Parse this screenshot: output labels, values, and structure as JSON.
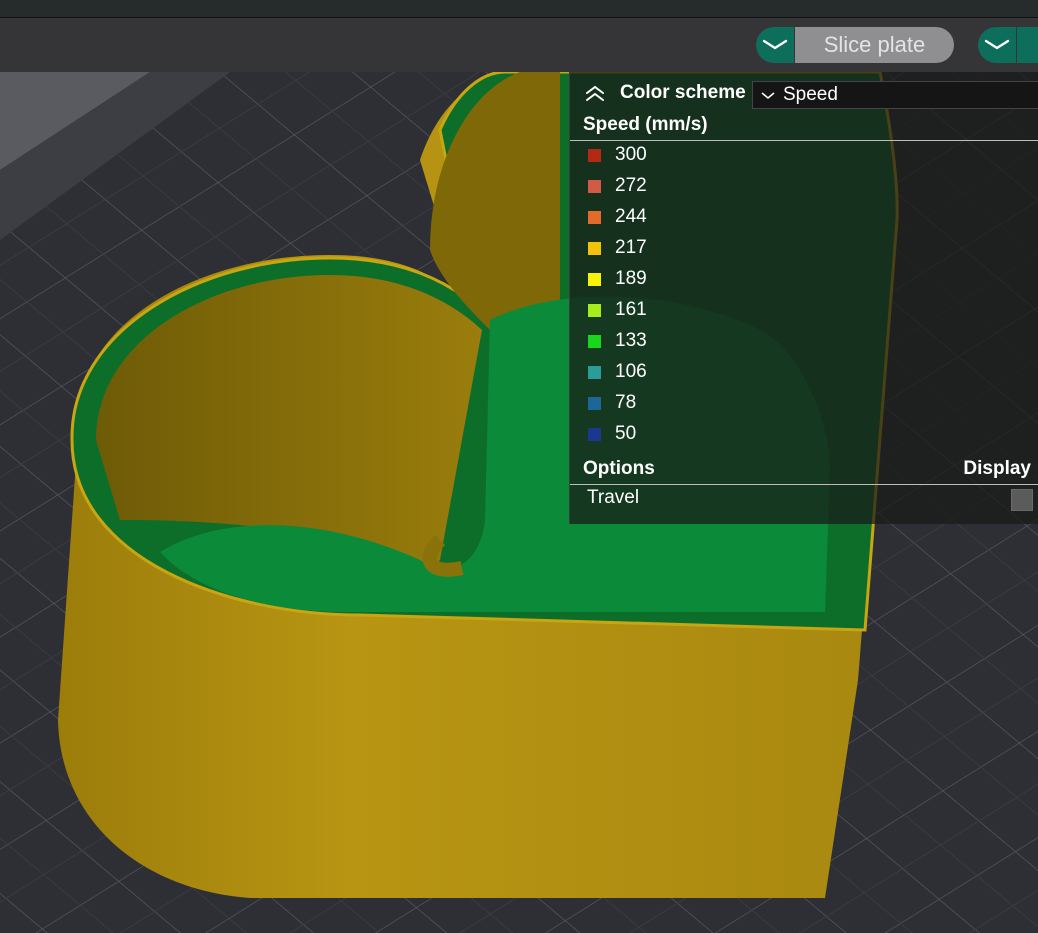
{
  "toolbar": {
    "slice_label": "Slice plate",
    "colors": {
      "accent": "#0e6e5c",
      "button_bg": "#8f8f92"
    }
  },
  "legend": {
    "scheme_label": "Color scheme",
    "scheme_value": "Speed",
    "speed_title": "Speed (mm/s)",
    "ranges": [
      {
        "value": "300",
        "color": "#b22a14"
      },
      {
        "value": "272",
        "color": "#d35a44"
      },
      {
        "value": "244",
        "color": "#e26a2a"
      },
      {
        "value": "217",
        "color": "#f2c10a"
      },
      {
        "value": "189",
        "color": "#f7f20a"
      },
      {
        "value": "161",
        "color": "#a6ec1a"
      },
      {
        "value": "133",
        "color": "#1ad61a"
      },
      {
        "value": "106",
        "color": "#2a9d9a"
      },
      {
        "value": "78",
        "color": "#1f6698"
      },
      {
        "value": "50",
        "color": "#1b3890"
      }
    ],
    "options_title": "Options",
    "display_title": "Display",
    "travel_label": "Travel"
  },
  "icons": [
    "chevron-down-icon",
    "chevron-up-double-icon"
  ]
}
